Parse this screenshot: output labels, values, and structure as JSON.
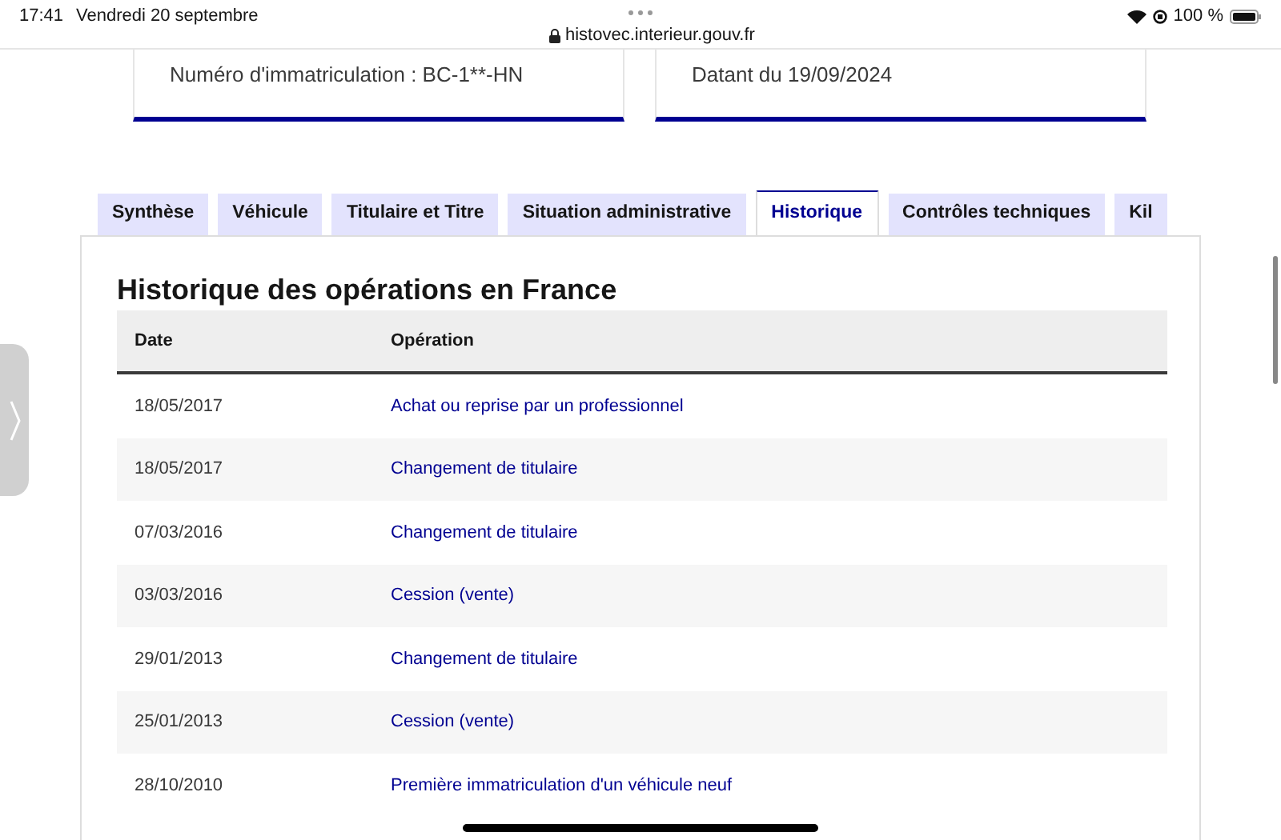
{
  "status_bar": {
    "time": "17:41",
    "date": "Vendredi 20 septembre",
    "url": "histovec.interieur.gouv.fr",
    "battery": "100 %"
  },
  "cards": [
    {
      "text": "Numéro d'immatriculation : BC-1**-HN"
    },
    {
      "text": "Datant du 19/09/2024"
    }
  ],
  "tabs": [
    {
      "label": "Synthèse",
      "selected": false
    },
    {
      "label": "Véhicule",
      "selected": false
    },
    {
      "label": "Titulaire et Titre",
      "selected": false
    },
    {
      "label": "Situation administrative",
      "selected": false
    },
    {
      "label": "Historique",
      "selected": true
    },
    {
      "label": "Contrôles techniques",
      "selected": false
    },
    {
      "label": "Kil",
      "selected": false
    }
  ],
  "section": {
    "title": "Historique des opérations en France",
    "table": {
      "columns": [
        "Date",
        "Opération"
      ],
      "rows": [
        {
          "date": "18/05/2017",
          "operation": "Achat ou reprise par un professionnel"
        },
        {
          "date": "18/05/2017",
          "operation": "Changement de titulaire"
        },
        {
          "date": "07/03/2016",
          "operation": "Changement de titulaire"
        },
        {
          "date": "03/03/2016",
          "operation": "Cession (vente)"
        },
        {
          "date": "29/01/2013",
          "operation": "Changement de titulaire"
        },
        {
          "date": "25/01/2013",
          "operation": "Cession (vente)"
        },
        {
          "date": "28/10/2010",
          "operation": "Première immatriculation d'un véhicule neuf"
        }
      ]
    }
  }
}
